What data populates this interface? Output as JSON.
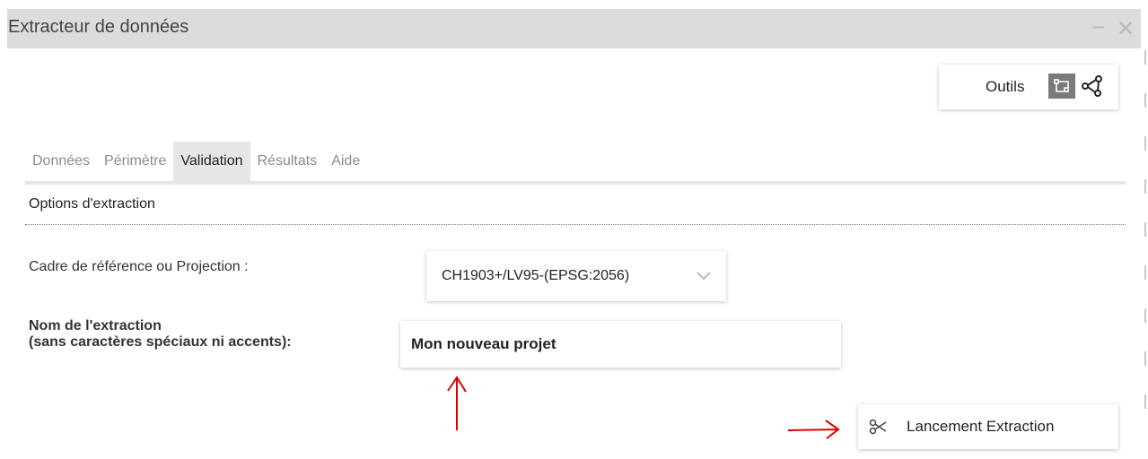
{
  "window": {
    "title": "Extracteur de données",
    "minimize_glyph": "−",
    "close_glyph": "✕"
  },
  "toolbar": {
    "tools_label": "Outils",
    "icons": [
      "select-tool-icon",
      "share-icon"
    ]
  },
  "tabs": [
    {
      "label": "Données",
      "active": false
    },
    {
      "label": "Périmètre",
      "active": false
    },
    {
      "label": "Validation",
      "active": true
    },
    {
      "label": "Résultats",
      "active": false
    },
    {
      "label": "Aide",
      "active": false
    }
  ],
  "options": {
    "section_title": "Options d'extraction",
    "projection_label": "Cadre de référence ou Projection :",
    "projection_value": "CH1903+/LV95-(EPSG:2056)",
    "name_label_line1": "Nom de l'extraction",
    "name_label_line2": "(sans caractères spéciaux ni accents):",
    "name_value": "Mon nouveau projet"
  },
  "actions": {
    "launch_label": "Lancement Extraction",
    "launch_icon": "scissors-icon"
  },
  "colors": {
    "titlebar": "#dcdcdc",
    "active_tab": "#e6e6e6",
    "annotation_arrow": "#e00000"
  }
}
